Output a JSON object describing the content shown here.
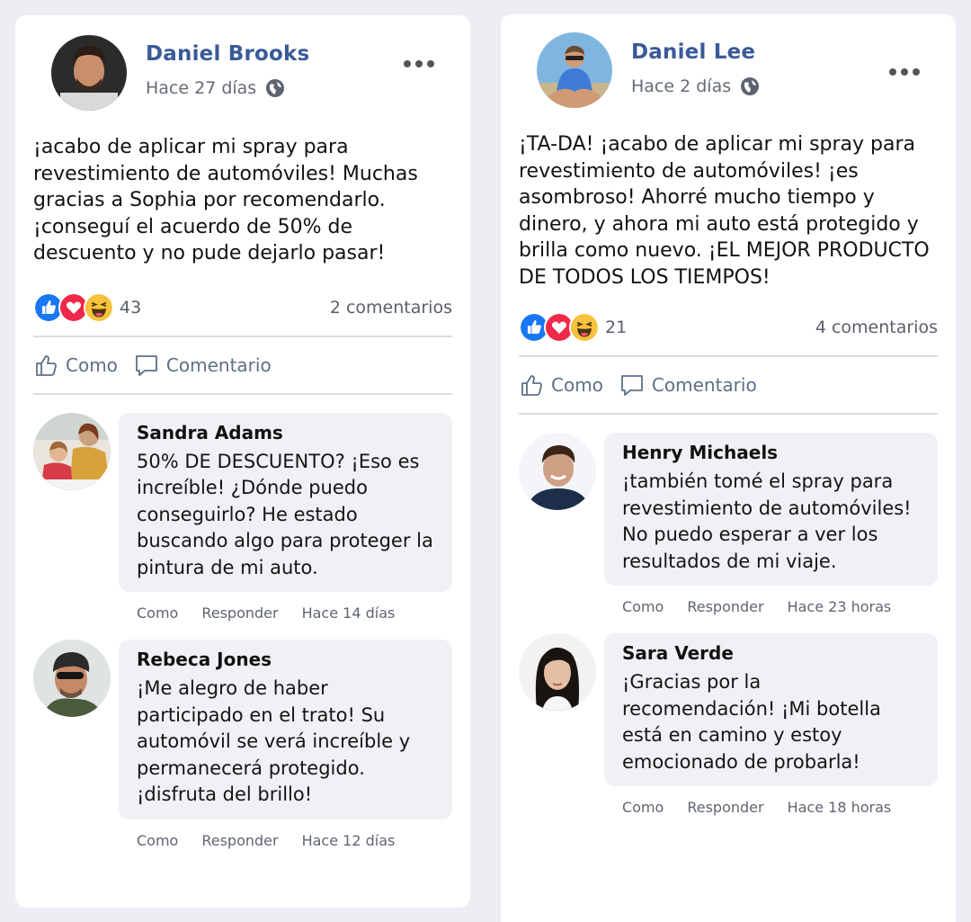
{
  "posts": [
    {
      "author": "Daniel Brooks",
      "time": "Hace 27 días",
      "text": "¡acabo de aplicar mi spray para revestimiento de automóviles! Muchas gracias a Sophia por recomendarlo. ¡conseguí el acuerdo de 50% de descuento y no pude dejarlo pasar!",
      "reaction_count": "43",
      "comments_count": "2 comentarios",
      "like_label": "Como",
      "comment_label": "Comentario",
      "comments": [
        {
          "author": "Sandra Adams",
          "text": "50% DE DESCUENTO? ¡Eso es increíble! ¿Dónde puedo conseguirlo? He estado buscando algo para proteger la pintura de mi auto.",
          "like": "Como",
          "reply": "Responder",
          "time": "Hace 14 días"
        },
        {
          "author": "Rebeca Jones",
          "text": "¡Me alegro de haber participado en el trato! Su automóvil se verá increíble y permanecerá protegido. ¡disfruta del brillo!",
          "like": "Como",
          "reply": "Responder",
          "time": "Hace 12 días"
        }
      ]
    },
    {
      "author": "Daniel Lee",
      "time": "Hace 2 días",
      "text": "¡TA-DA! ¡acabo de aplicar mi spray para revestimiento de automóviles! ¡es asombroso! Ahorré mucho tiempo y dinero, y ahora mi auto está protegido y brilla como nuevo. ¡EL MEJOR PRODUCTO DE TODOS LOS TIEMPOS!",
      "reaction_count": "21",
      "comments_count": "4 comentarios",
      "like_label": "Como",
      "comment_label": "Comentario",
      "comments": [
        {
          "author": "Henry Michaels",
          "text": "¡también tomé el spray para revestimiento de automóviles! No puedo esperar a ver los resultados de mi viaje.",
          "like": "Como",
          "reply": "Responder",
          "time": "Hace 23 horas"
        },
        {
          "author": "Sara Verde",
          "text": "¡Gracias por la recomendación! ¡Mi botella está en camino y estoy emocionado de probarla!",
          "like": "Como",
          "reply": "Responder",
          "time": "Hace 18 horas"
        }
      ]
    }
  ],
  "colors": {
    "author_blue": "#3a5a98",
    "like_blue": "#1877f2",
    "love_red": "#f02849",
    "haha_yellow": "#f7c33b",
    "bubble_bg": "#eff1f5"
  },
  "icons": [
    "globe-icon",
    "more-options-icon",
    "like-reaction-icon",
    "love-reaction-icon",
    "haha-reaction-icon",
    "thumbs-up-icon",
    "comment-icon"
  ]
}
